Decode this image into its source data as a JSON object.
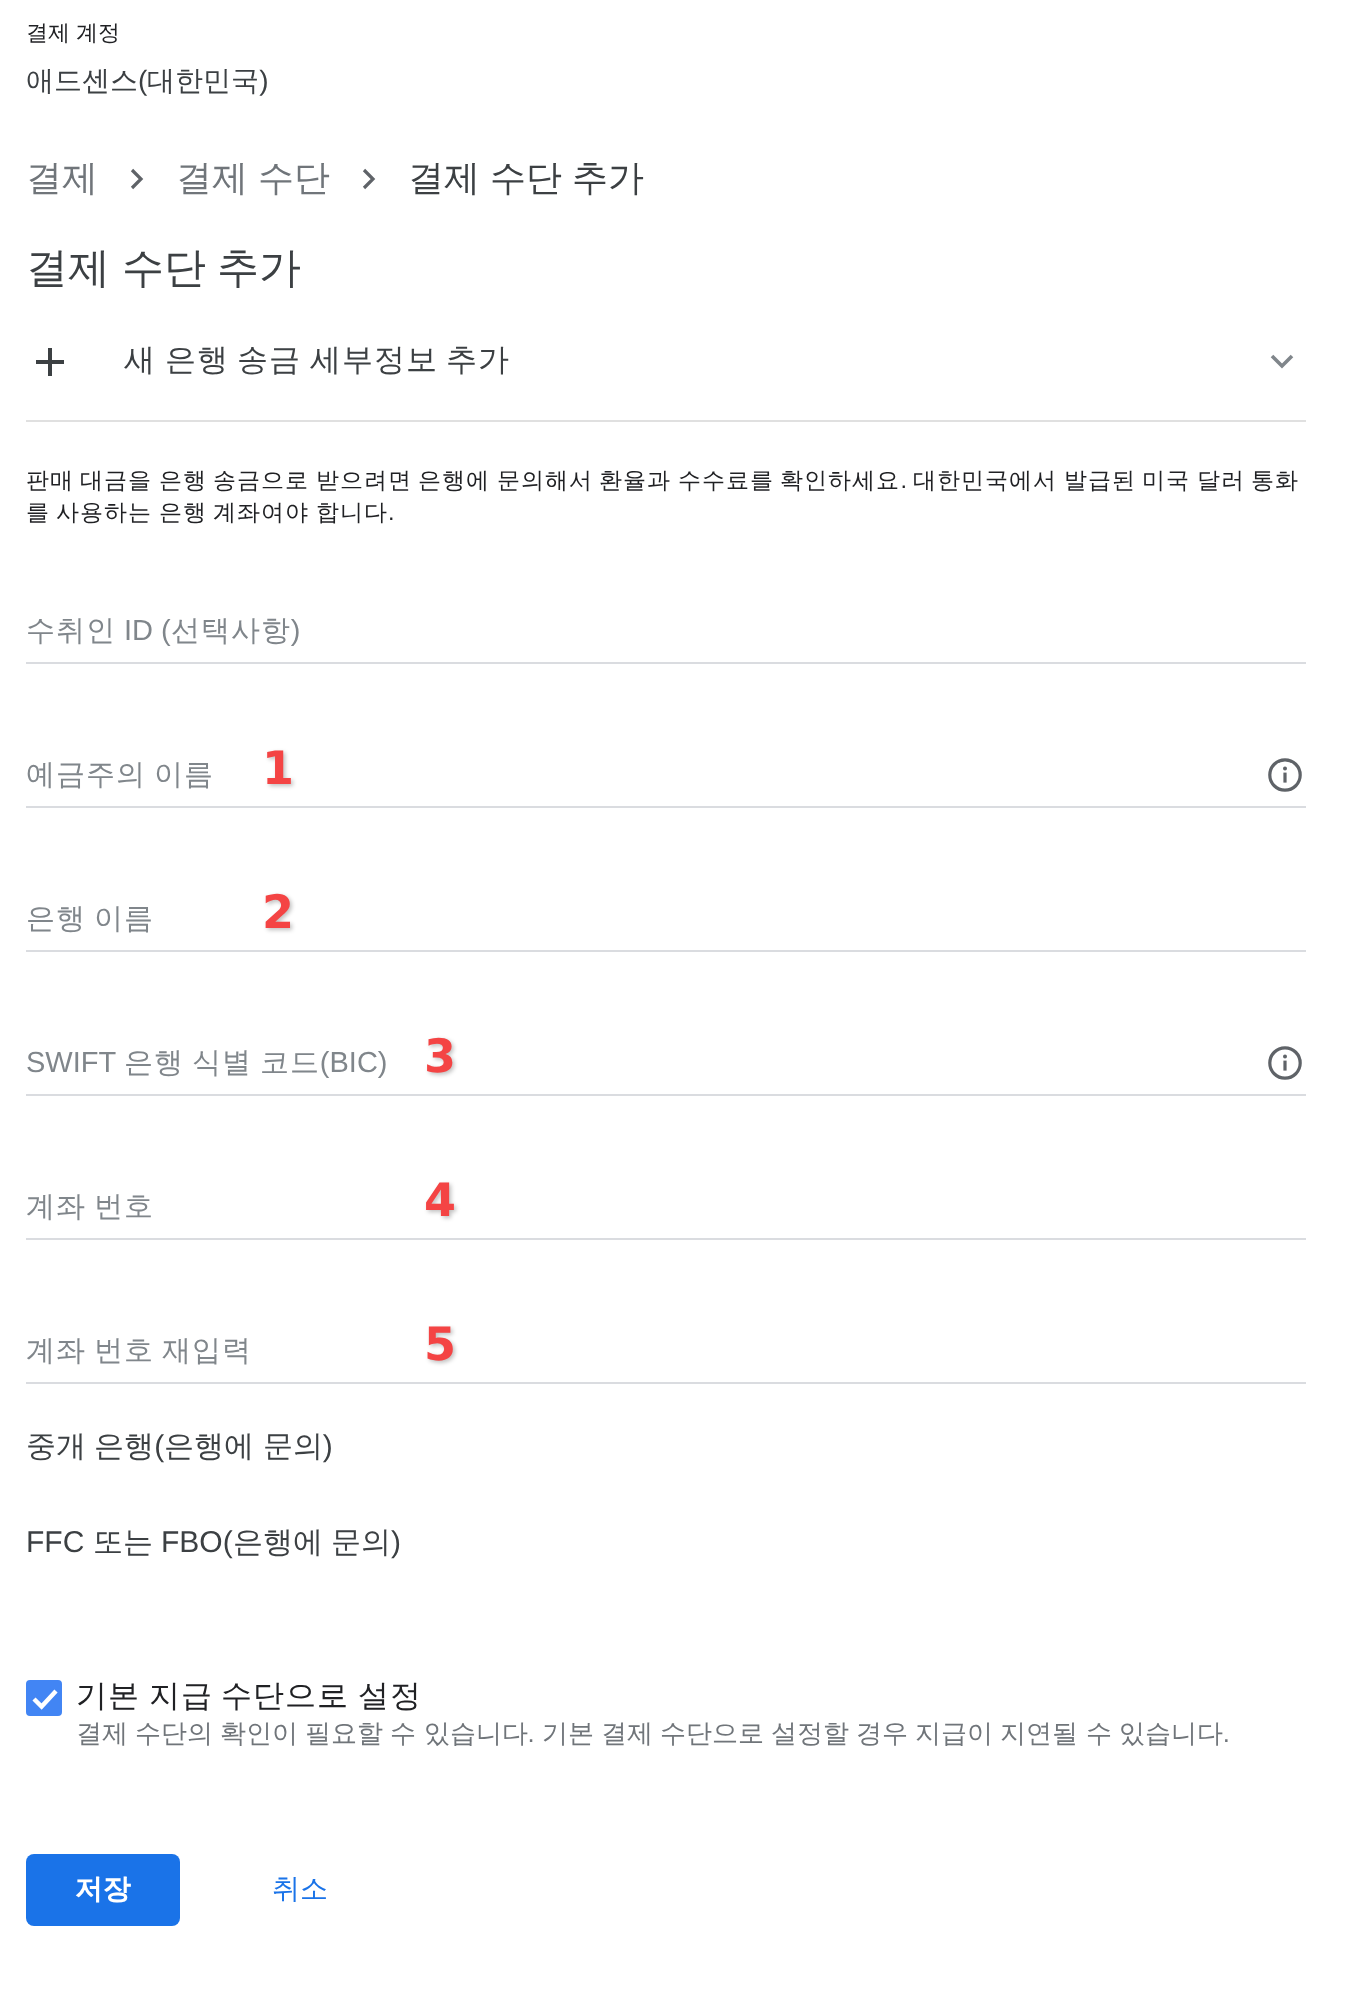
{
  "account": {
    "label": "결제 계정",
    "name": "애드센스(대한민국)"
  },
  "breadcrumb": [
    {
      "label": "결제",
      "current": false
    },
    {
      "label": "결제 수단",
      "current": false
    },
    {
      "label": "결제 수단 추가",
      "current": true
    }
  ],
  "title": "결제 수단 추가",
  "expander": {
    "label": "새 은행 송금 세부정보 추가",
    "expanded": false
  },
  "notice": "판매 대금을 은행 송금으로 받으려면 은행에 문의해서 환율과 수수료를 확인하세요. 대한민국에서 발급된 미국 달러 통화를 사용하는 은행 계좌여야 합니다.",
  "fields": [
    {
      "placeholder": "수취인 ID (선택사항)",
      "info": false
    },
    {
      "placeholder": "예금주의 이름",
      "info": true,
      "annotation": "1"
    },
    {
      "placeholder": "은행 이름",
      "info": false,
      "annotation": "2"
    },
    {
      "placeholder": "SWIFT 은행 식별 코드(BIC)",
      "info": true,
      "annotation": "3"
    },
    {
      "placeholder": "계좌 번호",
      "info": false,
      "annotation": "4"
    },
    {
      "placeholder": "계좌 번호 재입력",
      "info": false,
      "annotation": "5"
    }
  ],
  "optional_sections": [
    "중개 은행(은행에 문의)",
    "FFC 또는 FBO(은행에 문의)"
  ],
  "default_payment": {
    "label": "기본 지급 수단으로 설정",
    "hint": "결제 수단의 확인이 필요할 수 있습니다. 기본 결제 수단으로 설정할 경우 지급이 지연될 수 있습니다.",
    "checked": true
  },
  "buttons": [
    {
      "label": "저장",
      "kind": "primary"
    },
    {
      "label": "취소",
      "kind": "text"
    }
  ]
}
